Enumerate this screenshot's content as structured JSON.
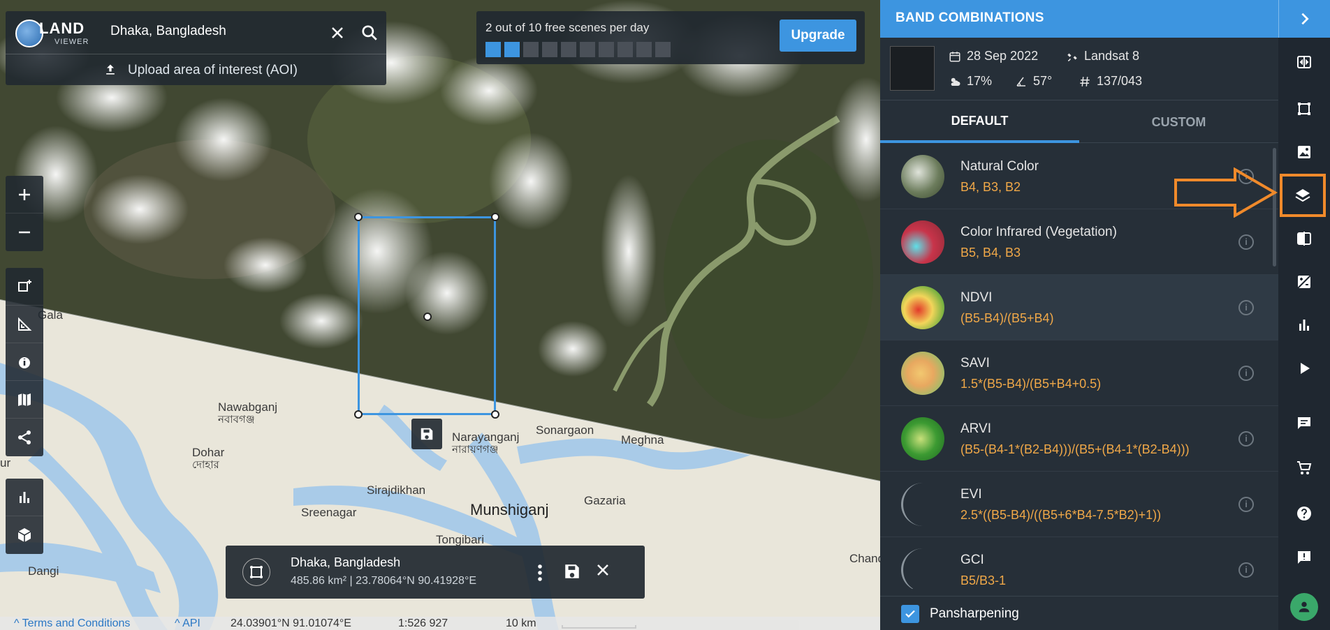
{
  "search": {
    "logo_top": "LAND",
    "logo_bottom": "VIEWER",
    "query": "Dhaka, Bangladesh",
    "upload_label": "Upload area of interest (AOI)"
  },
  "quota": {
    "text": "2 out of 10 free scenes per day",
    "used": 2,
    "total": 10,
    "upgrade_label": "Upgrade"
  },
  "map_labels": {
    "gala": "Gala",
    "ur": "ur",
    "nawabganj": "Nawabganj",
    "nawabganj_bn": "নবাবগঞ্জ",
    "dohar": "Dohar",
    "dohar_bn": "দোহার",
    "narayanganj": "Narayanganj",
    "narayanganj_bn": "নারায়ণগঞ্জ",
    "sonargaon": "Sonargaon",
    "meghna": "Meghna",
    "sirajdikhan": "Sirajdikhan",
    "sreenagar": "Sreenagar",
    "munshiganj": "Munshiganj",
    "gazaria": "Gazaria",
    "tongibari": "Tongibari",
    "dangi": "Dangi",
    "chand": "Chand"
  },
  "aoi": {
    "name": "Dhaka, Bangladesh",
    "details": "485.86 km² | 23.78064°N 90.41928°E"
  },
  "status": {
    "terms": "Terms and Conditions",
    "api": "API",
    "coords": "24.03901°N 91.01074°E",
    "scale": "1:526 927",
    "distance": "10 km"
  },
  "panel": {
    "title": "BAND COMBINATIONS",
    "scene": {
      "date": "28 Sep 2022",
      "satellite": "Landsat 8",
      "cloud": "17%",
      "angle": "57°",
      "path_row": "137/043"
    },
    "tabs": [
      "DEFAULT",
      "CUSTOM"
    ],
    "active_tab": "DEFAULT",
    "bands": [
      {
        "name": "Natural Color",
        "formula": "B4, B3, B2"
      },
      {
        "name": "Color Infrared (Vegetation)",
        "formula": "B5, B4, B3"
      },
      {
        "name": "NDVI",
        "formula": "(B5-B4)/(B5+B4)"
      },
      {
        "name": "SAVI",
        "formula": "1.5*(B5-B4)/(B5+B4+0.5)"
      },
      {
        "name": "ARVI",
        "formula": "(B5-(B4-1*(B2-B4)))/(B5+(B4-1*(B2-B4)))"
      },
      {
        "name": "EVI",
        "formula": "2.5*((B5-B4)/((B5+6*B4-7.5*B2)+1))"
      },
      {
        "name": "GCI",
        "formula": "B5/B3-1"
      }
    ],
    "selected_band": "NDVI",
    "pansharpening_label": "Pansharpening",
    "pansharpening_checked": true
  },
  "rail": {
    "icons": [
      "compare-icon",
      "aoi-icon",
      "image-icon",
      "layers-icon",
      "split-icon",
      "change-detection-icon",
      "analytics-icon",
      "play-icon",
      "chat-icon",
      "cart-icon",
      "help-icon",
      "feedback-icon"
    ],
    "highlighted": "layers-icon"
  },
  "colors": {
    "accent": "#3d95e0",
    "formula": "#f0a848",
    "highlight": "#f08a2b"
  }
}
